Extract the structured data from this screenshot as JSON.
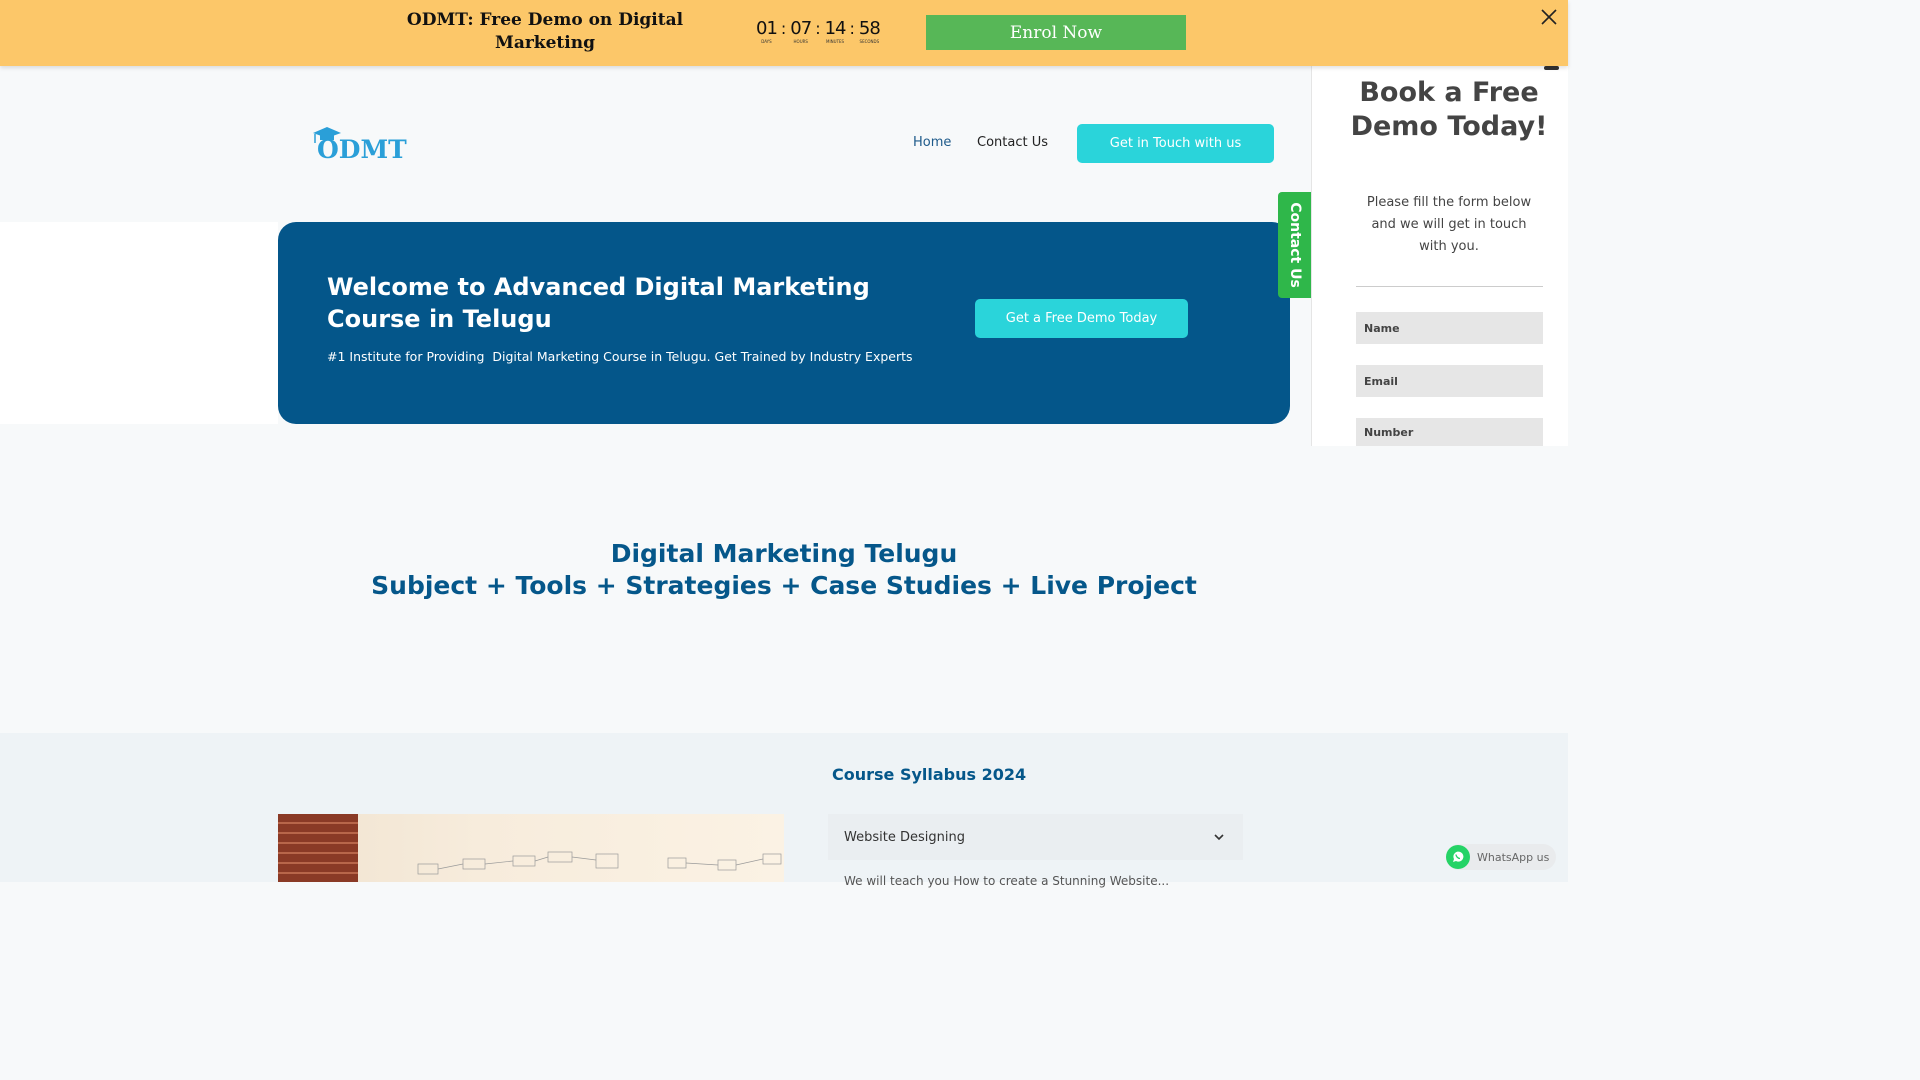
{
  "promo": {
    "title": "ODMT: Free Demo on Digital Marketing",
    "countdown": [
      {
        "value": "01",
        "label": "DAYS"
      },
      {
        "value": "07",
        "label": "HOURS"
      },
      {
        "value": "14",
        "label": "MINUTES"
      },
      {
        "value": "58",
        "label": "SECONDS"
      }
    ],
    "separator": ":",
    "enrol_label": "Enrol Now"
  },
  "header": {
    "logo_text": "ODMT",
    "nav": [
      {
        "label": "Home"
      },
      {
        "label": "Contact Us"
      }
    ],
    "cta_label": "Get in Touch with us"
  },
  "hero": {
    "title": "Welcome to Advanced Digital Marketing Course in Telugu",
    "subtitle": "#1 Institute for Providing  Digital Marketing Course in Telugu. Get Trained by Industry Experts",
    "button_label": "Get a Free Demo Today"
  },
  "contact_tab": {
    "label": "Contact Us"
  },
  "side_form": {
    "title": "Book a Free Demo Today!",
    "description": "Please fill the form below and we will get in touch with you.",
    "fields": [
      {
        "placeholder": "Name"
      },
      {
        "placeholder": "Email"
      },
      {
        "placeholder": "Number"
      }
    ]
  },
  "section": {
    "line1": "Digital Marketing Telugu",
    "line2": "Subject + Tools + Strategies + Case Studies + Live Project"
  },
  "syllabus": {
    "title": "Course Syllabus 2024",
    "accordion": [
      {
        "label": "Website Designing",
        "preview": "We will teach you How to create a Stunning Website..."
      }
    ]
  },
  "whatsapp": {
    "label": "WhatsApp us"
  },
  "colors": {
    "promo_bg": "#fcc769",
    "enrol_bg": "#57b757",
    "brand_blue": "#04568a",
    "accent_cyan": "#2ad4da",
    "contact_green": "#2fb74a"
  }
}
